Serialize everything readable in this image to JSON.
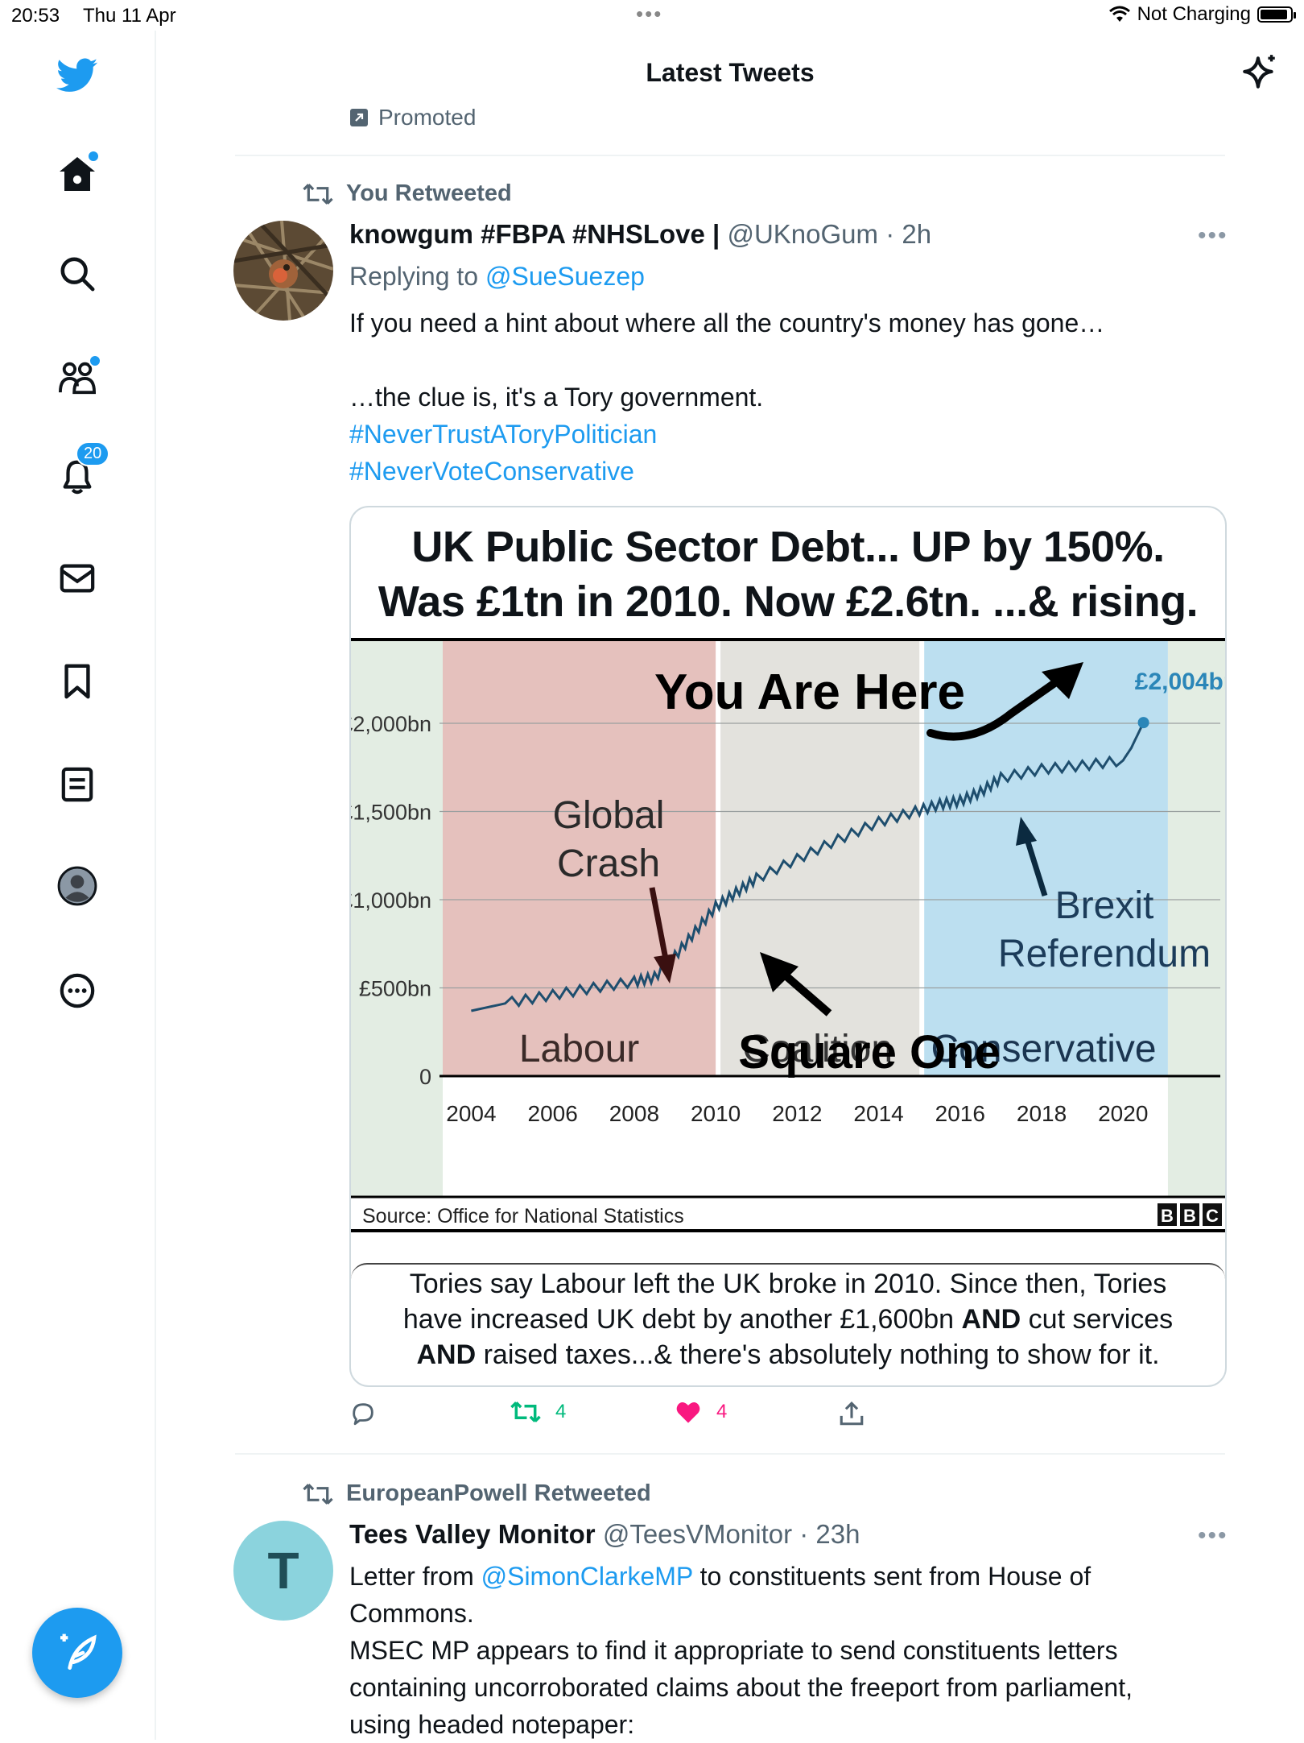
{
  "status": {
    "time": "20:53",
    "date": "Thu 11 Apr",
    "charging": "Not Charging"
  },
  "header": {
    "title": "Latest Tweets"
  },
  "sidebar": {
    "notifications_count": "20"
  },
  "promoted_label": "Promoted",
  "tweet1": {
    "context": "You Retweeted",
    "name": "knowgum #FBPA #NHSLove |",
    "handle": "@UKnoGum",
    "time": "· 2h",
    "replying_prefix": "Replying to",
    "replying_to": "@SueSuezep",
    "line1": "If you need a hint about where all the country's money has gone…",
    "line2": "…the clue is, it's a Tory government.",
    "hashtag1": "#NeverTrustAToryPolitician",
    "hashtag2": "#NeverVoteConservative",
    "image": {
      "title_line1": "UK Public Sector Debt... UP by 150%.",
      "title_line2": "Was £1tn in 2010.   Now £2.6tn.  ...& rising.",
      "source": "Source: Office for National Statistics",
      "brand": "BBC",
      "annotations": {
        "you_are_here": "You Are Here",
        "end_value": "£2,004bn",
        "global": "Global",
        "crash": "Crash",
        "square_one": "Square One",
        "brexit": "Brexit",
        "referendum": "Referendum"
      },
      "caption_line1": "Tories say Labour left the UK broke in 2010.  Since then, Tories",
      "caption_line2a": "have increased UK debt by another £1,600bn ",
      "caption_line2b": "AND",
      "caption_line2c": " cut services",
      "caption_line3a": "AND",
      "caption_line3b": " raised taxes...& there's absolutely nothing to show for it."
    },
    "stats": {
      "retweets": "4",
      "likes": "4"
    }
  },
  "tweet2": {
    "context": "EuropeanPowell Retweeted",
    "avatar_letter": "T",
    "name": "Tees Valley Monitor",
    "handle": "@TeesVMonitor",
    "time": "· 23h",
    "line1_prefix": "Letter from ",
    "line1_mention": "@SimonClarkeMP",
    "line1_suffix": " to constituents sent from House of",
    "line2": "Commons.",
    "line3": "MSEC MP appears to find it appropriate to send constituents letters",
    "line4": "containing uncorroborated claims about the freeport from parliament,",
    "line5": "using headed notepaper:"
  },
  "chart_data": {
    "type": "line",
    "title": "",
    "xlabel": "",
    "ylabel": "",
    "x_ticks": [
      "2004",
      "2006",
      "2008",
      "2010",
      "2012",
      "2014",
      "2016",
      "2018",
      "2020"
    ],
    "y_ticks": [
      "0",
      "£500bn",
      "£1,000bn",
      "£1,500bn",
      "£2,000bn"
    ],
    "ylim": [
      0,
      2000
    ],
    "xlim": [
      2003.3,
      2021.2
    ],
    "x": [
      2004.0,
      2005.0,
      2006.0,
      2007.0,
      2008.0,
      2008.5,
      2009.0,
      2009.5,
      2010.0,
      2010.5,
      2011.0,
      2012.0,
      2013.0,
      2014.0,
      2014.9,
      2015.5,
      2016.0,
      2016.5,
      2017.0,
      2018.0,
      2019.0,
      2020.0,
      2020.2,
      2020.5
    ],
    "series": [
      {
        "values": [
          370,
          420,
          460,
          500,
          535,
          560,
          680,
          820,
          960,
          1040,
          1120,
          1230,
          1340,
          1440,
          1500,
          1540,
          1560,
          1610,
          1690,
          1740,
          1760,
          1790,
          1860,
          2004
        ]
      }
    ],
    "bands": [
      {
        "label": "Labour",
        "from": 2003.3,
        "to": 2010.0,
        "color": "#e5c1bd"
      },
      {
        "label": "Coalition",
        "from": 2010.0,
        "to": 2015.0,
        "color": "#e3e2dd"
      },
      {
        "label": "Conservative",
        "from": 2015.0,
        "to": 2021.1,
        "color": "#bcdff0"
      }
    ],
    "line_color": "#1e4e6e",
    "grid": true
  }
}
